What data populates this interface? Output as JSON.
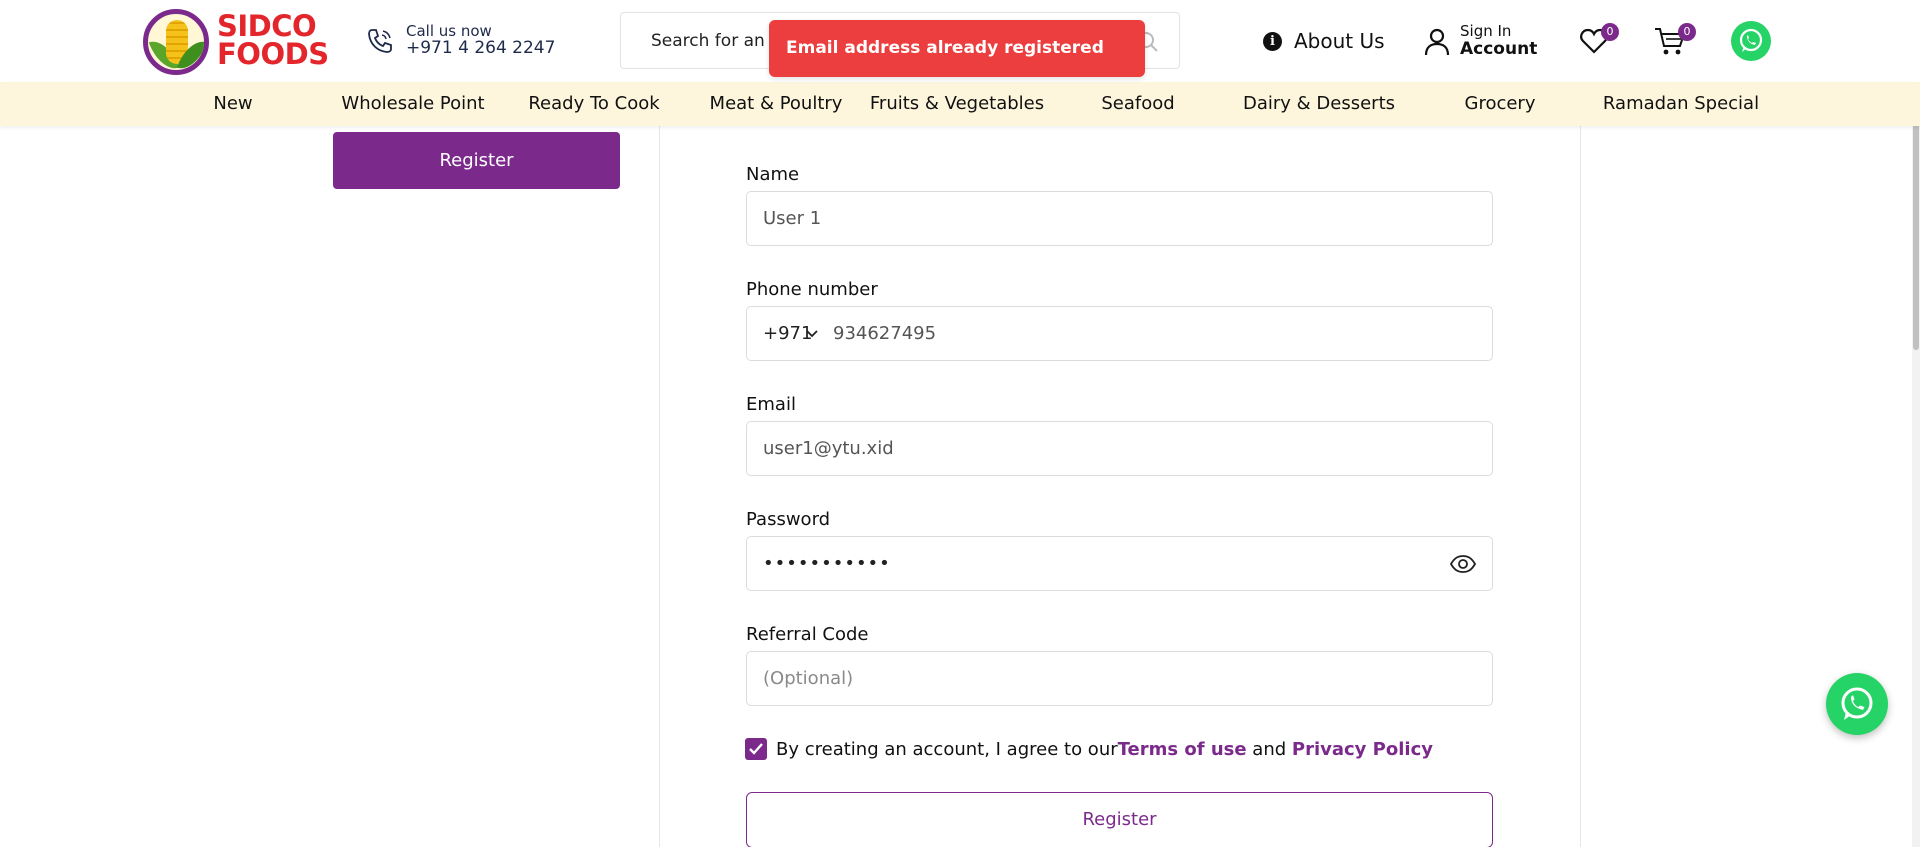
{
  "brand": {
    "line1": "SIDCO",
    "line2": "FOODS"
  },
  "contact": {
    "label": "Call us now",
    "number": "+971 4 264 2247"
  },
  "search": {
    "placeholder": "Search for an"
  },
  "toast": {
    "message": "Email address already registered"
  },
  "header": {
    "about": "About Us",
    "about_icon": "info-icon",
    "account_top": "Sign In",
    "account_bottom": "Account",
    "wishlist_count": "0",
    "cart_count": "0"
  },
  "categories": [
    "New",
    "Wholesale Point",
    "Ready To Cook",
    "Meat & Poultry",
    "Fruits & Vegetables",
    "Seafood",
    "Dairy & Desserts",
    "Grocery",
    "Ramadan Special"
  ],
  "sidebar": {
    "register_label": "Register"
  },
  "form": {
    "name_label": "Name",
    "name_value": "User 1",
    "phone_label": "Phone number",
    "phone_code": "+971",
    "phone_value": "934627495",
    "email_label": "Email",
    "email_value": "user1@ytu.xid",
    "password_label": "Password",
    "password_value": "•••••••••••",
    "referral_label": "Referral Code",
    "referral_placeholder": "(Optional)",
    "consent_text": "By creating an account, I agree to our ",
    "terms_link": "Terms of use",
    "and_text": " and ",
    "privacy_link": "Privacy Policy",
    "submit_label": "Register"
  },
  "colors": {
    "brand_purple": "#7b2a8c",
    "brand_red": "#e3262b",
    "toast_red": "#ec3d3f",
    "whatsapp_green": "#25d366",
    "catbar_bg": "#fdf6dd"
  }
}
